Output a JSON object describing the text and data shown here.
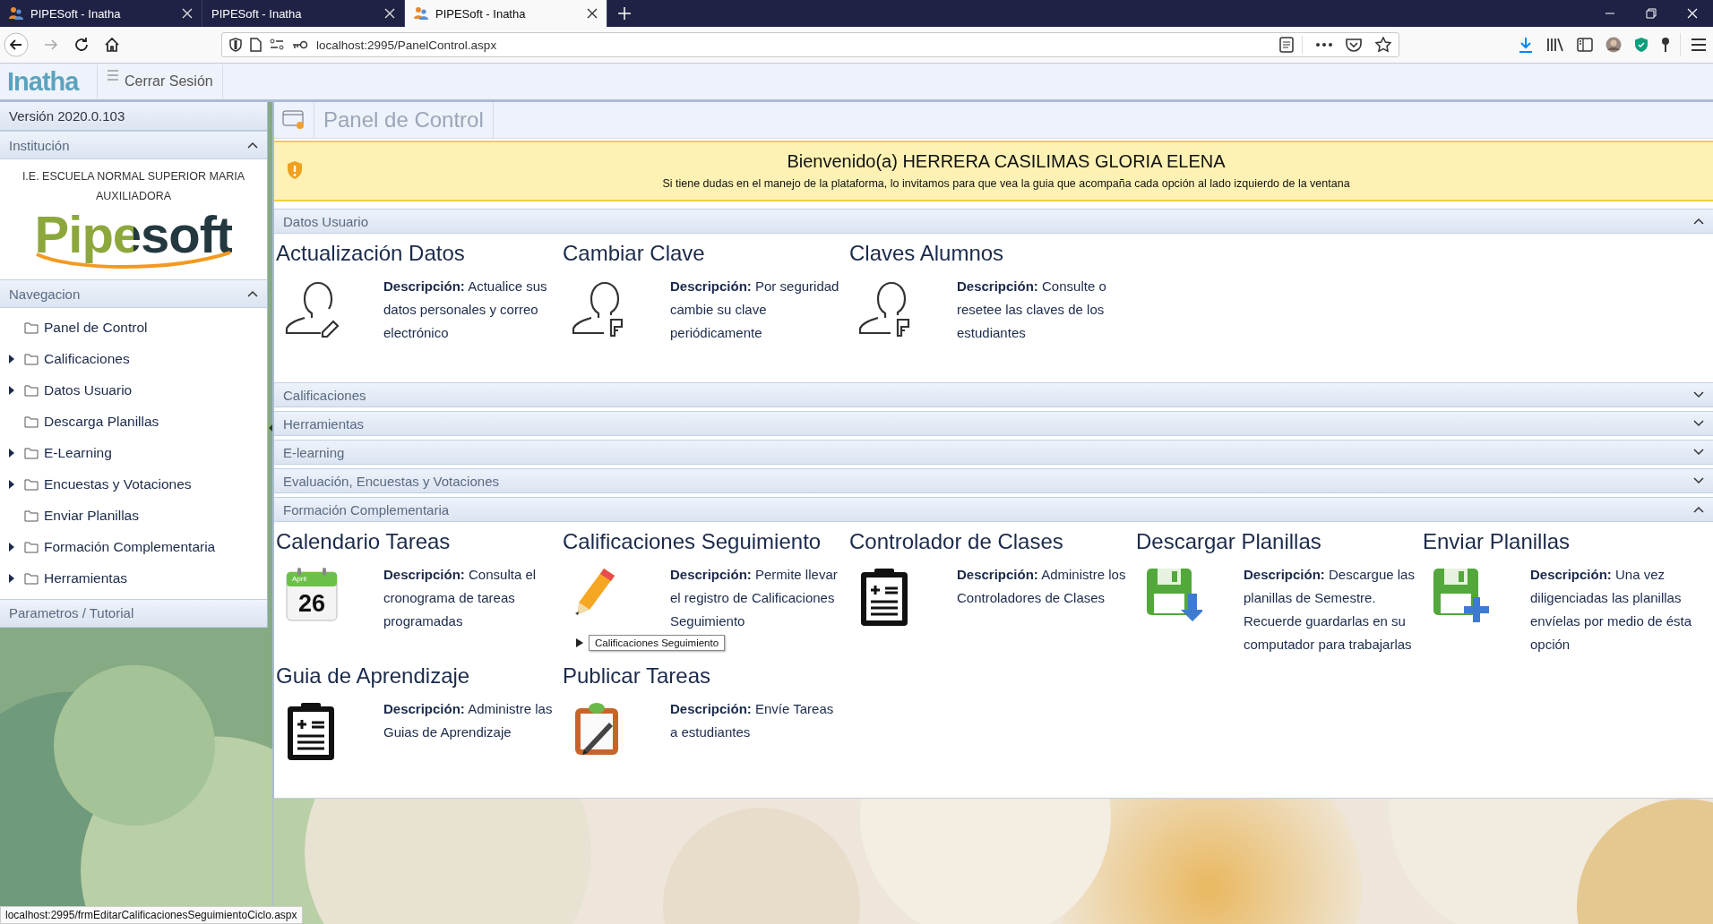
{
  "browser": {
    "tabs": [
      {
        "title": "PIPESoft - Inatha",
        "icon": true,
        "selected": false
      },
      {
        "title": "PIPESoft - Inatha",
        "icon": false,
        "selected": false
      },
      {
        "title": "PIPESoft - Inatha",
        "icon": true,
        "selected": true
      }
    ],
    "url": "localhost:2995/PanelControl.aspx",
    "status_url": "localhost:2995/frmEditarCalificacionesSeguimientoCiclo.aspx"
  },
  "app_header": {
    "logo": "Inatha",
    "menu_item": "Cerrar Sesión"
  },
  "sidebar": {
    "version": "Versión 2020.0.103",
    "institution": {
      "header": "Institución",
      "expanded": true,
      "name": "I.E. ESCUELA NORMAL SUPERIOR MARIA AUXILIADORA",
      "logo": "Pipesoft"
    },
    "navigation": {
      "header": "Navegacion",
      "expanded": true,
      "items": [
        {
          "label": "Panel de Control",
          "has_children": false
        },
        {
          "label": "Calificaciones",
          "has_children": true
        },
        {
          "label": "Datos Usuario",
          "has_children": true
        },
        {
          "label": "Descarga Planillas",
          "has_children": false
        },
        {
          "label": "E-Learning",
          "has_children": true
        },
        {
          "label": "Encuestas y Votaciones",
          "has_children": true
        },
        {
          "label": "Enviar Planillas",
          "has_children": false
        },
        {
          "label": "Formación Complementaria",
          "has_children": true
        },
        {
          "label": "Herramientas",
          "has_children": true
        }
      ]
    },
    "footer": "Parametros / Tutorial"
  },
  "panel": {
    "title": "Panel de Control",
    "welcome": {
      "title": "Bienvenido(a) HERRERA CASILIMAS GLORIA ELENA",
      "text": "Si tiene dudas en el manejo de la plataforma, lo invitamos para que vea la guia que acompaña cada opción al lado izquierdo de la ventana"
    },
    "sections": [
      {
        "title": "Datos Usuario",
        "expanded": true,
        "cards": [
          {
            "title": "Actualización Datos",
            "kind": "user-edit",
            "description": "**Descripción:** Actualice sus datos personales y correo electrónico"
          },
          {
            "title": "Cambiar Clave",
            "kind": "user-key",
            "description": "**Descripción:** Por seguridad cambie su clave periódicamente"
          },
          {
            "title": "Claves Alumnos",
            "kind": "user-key",
            "description": "**Descripción:** Consulte o resetee las claves de los estudiantes"
          }
        ]
      },
      {
        "title": "Calificaciones",
        "expanded": false
      },
      {
        "title": "Herramientas",
        "expanded": false
      },
      {
        "title": "E-learning",
        "expanded": false
      },
      {
        "title": "Evaluación, Encuestas y Votaciones",
        "expanded": false
      },
      {
        "title": "Formación Complementaria",
        "expanded": true,
        "cards": [
          {
            "title": "Calendario Tareas",
            "kind": "calendar",
            "month": "April",
            "day": "26",
            "description": "**Descripción:** Consulta el cronograma de tareas programadas"
          },
          {
            "title": "Calificaciones Seguimiento",
            "kind": "pencil",
            "description": "**Descripción:** Permite llevar el registro de Calificaciones Seguimiento"
          },
          {
            "title": "Controlador de Clases",
            "kind": "clipboard-list",
            "description": "**Descripción:** Administre los Controladores de Clases"
          },
          {
            "title": "Descargar Planillas",
            "kind": "floppy-down",
            "description": "**Descripción:** Descargue las planillas de Semestre. Recuerde guardarlas en su computador para trabajarlas"
          },
          {
            "title": "Enviar Planillas",
            "kind": "floppy-plus",
            "description": "**Descripción:** Una vez diligenciadas las planillas envíelas por medio de ésta opción"
          },
          {
            "title": "Guia de Aprendizaje",
            "kind": "clipboard-list",
            "description": "**Descripción:** Administre las Guias de Aprendizaje"
          },
          {
            "title": "Publicar Tareas",
            "kind": "clipboard-pen",
            "description": "**Descripción:** Envíe Tareas a estudiantes"
          }
        ]
      }
    ]
  },
  "tooltip": {
    "text": "Calificaciones Seguimiento"
  }
}
